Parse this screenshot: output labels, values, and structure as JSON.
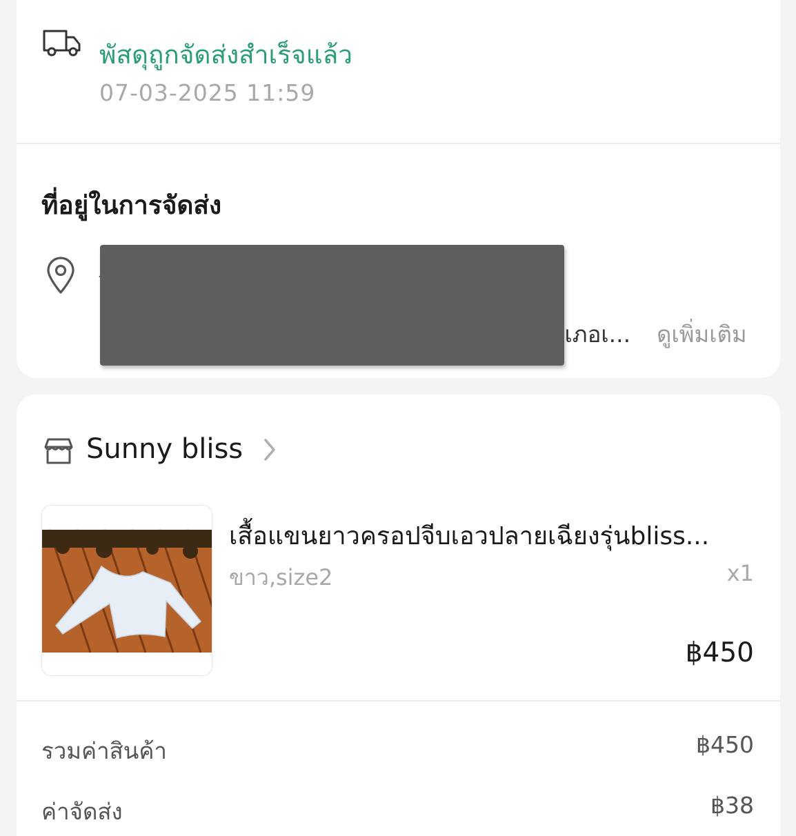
{
  "delivery": {
    "status": "พัสดุถูกจัดส่งสำเร็จแล้ว",
    "timestamp": "07-03-2025 11:59",
    "icon": "truck-icon",
    "status_color": "#2a9d77"
  },
  "address": {
    "title": "ที่อยู่ในการจัดส่ง",
    "line_visible_start": "ว",
    "line_truncated_end": "าเภอเ...",
    "see_more": "ดูเพิ่มเติม",
    "icon": "location-pin-icon"
  },
  "shop": {
    "name": "Sunny bliss",
    "icon": "store-icon",
    "chevron": "chevron-right-icon"
  },
  "product": {
    "name": "เสื้อแขนยาวครอปจีบเอวปลายเฉียงรุ่นbliss...",
    "variant": "ขาว,size2",
    "quantity": "x1",
    "price": "฿450"
  },
  "summary": {
    "rows": [
      {
        "label": "รวมค่าสินค้า",
        "value": "฿450"
      },
      {
        "label": "ค่าจัดส่ง",
        "value": "฿38"
      }
    ]
  }
}
